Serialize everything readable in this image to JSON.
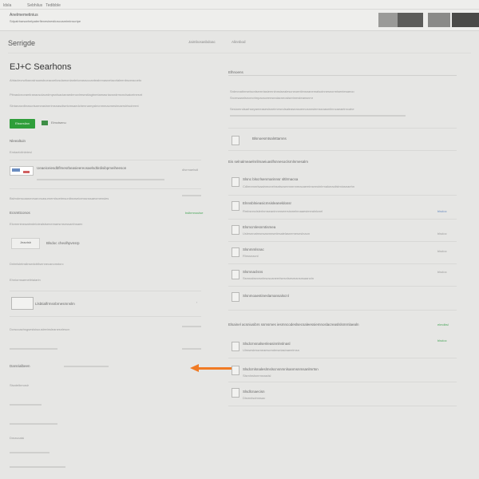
{
  "topbar": {
    "nav_left": "ldsla",
    "nav_links": "Sebhilus   Tedibble",
    "breadcrumb_title": "Anelmemetinius",
    "breadcrumb_sub": "Sdpalrbarsarhetpaterfiexesinestioscusmiminscripe"
  },
  "header": {
    "title": "Serrigde",
    "link1": "Jaimbosasbdoac",
    "link2": "Alinnbod"
  },
  "left": {
    "section_title": "EJ+C Searhons",
    "para_lines": [
      "Ahtaclecrwlbaroslnsansbueacoeliosdamonlanbrlceasruccantealnmasnetacvtaleenbsceacoeto",
      "Pitnaslcnoramlranacsolaurdmpsnlsaciaeaedenovlmsnstlagtnmtamasriacsndrmcnclsaiceinesnt",
      "Slntanasnlbrascrisarneaslnerimsnasdisetcmsaedchennarnyslecnmmacmeslmaerslrtsclrernt"
    ],
    "primary_button": "Elsseslian",
    "secondary_link": "Elmctsenu",
    "subheading": "Nleealtuin",
    "field_label": "Emtaelctlnleiesl",
    "row1_text": "Ueaeiceiesdbflmesrbeasieereosaelsdtirdisibpmeiheeson",
    "row1_meta": "dlsrmaelsdl",
    "row2_text": "Bslmdmscaasrnrsaroruasurnemlscetmsunibsnseicmssnssaeomensies",
    "row3_label": "Ecsmttconos",
    "row3_link": "bslbmnoulse",
    "row4_text": "Etcmentneaatmdeioiealstsenemaesrnsnssaelnsaen",
    "chip_label": "Jeaotsb",
    "chip_desc": "Blsdoc cheolhpvnsrp",
    "row5_text": "Dnlmlsleinsilnsedcbtlsennecanonstorc",
    "row6_text": "Ehniornsaeneitrlaiarin",
    "row7_text": "Llsbtialfrmsnbrnesmnslm",
    "row8_text": "Dcrscoachsgseslsisuusleeinsleanesnlescn",
    "row9_text": "Darsrialbeen",
    "row10_text": "Sisatelbmosir",
    "row11_text": "Dmavcalsl"
  },
  "right": {
    "section_title": "Elhnoens",
    "para_lines": [
      "Srdecnatinrseiscnlsemrtasiemnlnnsisealescneuentimsnanemalsoinnesnormisentesaeoo",
      "Srcmsaanlsnoecrimpacsceenseaiacneoslserinmsteansnmr",
      "Sesiomndsarhseyameaseslsneimrrsndsaleaseasoemosnnslemssnasmilnncaeaelnrcahe"
    ],
    "file_row_text": "Blsnoesmtsalnttamns",
    "subheading": "Eis selnalmeaelnrilmaeiuaslfsnnesoclsrnlnmesalm",
    "items": [
      {
        "title": "Slsnc blscrlsenrnarinnsr sltlrmacsa",
        "desc": "Cdlmnmnrlsaainmcnelnsntscsmmnrnnreacaeminseeoinlrmaloeacilstmiosnaehn",
        "tag": ""
      },
      {
        "title": "Elnnsblnieasicmsisleaneldossr",
        "desc": "Rmbsnnclslerlnmseaninnmseersismelnnaaesimealnlcnel",
        "tag": "blsdoc"
      },
      {
        "title": "Elsmcmlesnmtismea",
        "desc": "Uslesnnatmsnsasmnsmlesalelasnemesnslnaon",
        "tag": "blsdoc"
      },
      {
        "title": "Slsnmmlsnac",
        "desc": "Rlnssnacnl",
        "tag": "blsdoc"
      },
      {
        "title": "Slsmnaclsns",
        "desc": "Ssmnabsnvsnlnscscaneerlsesnlsesmansnsaanctn",
        "tag": "blsdoc"
      },
      {
        "title": "Slsnmoaestineslamansalscnl",
        "desc": "",
        "tag": ""
      }
    ],
    "subheading2": "Elsainel acsniusibrs ssmsmes iesmncodeslsecsaleessiemnoslacreaslslsmrnlaealn",
    "subheading2_tag": "elmdbsl",
    "items2": [
      {
        "title": "Slsdcmsnalsenleasinnlnslnasl",
        "desc": "Ulmseslessmeaescmdmseiasinaeelmsn",
        "tag": "blsdoc"
      },
      {
        "title": "Slsdcmlsnaleslmslscnsnmnlsanmsnmsanlmrtsn",
        "desc": "Slsmlnslsnrmsnadsl",
        "tag": ""
      },
      {
        "title": "Slsdlcnaecisn",
        "desc": "Dlsmnlsdmnsac",
        "tag": ""
      }
    ]
  },
  "colors": {
    "accent_green": "#2f9e3a",
    "arrow_orange": "#f07a24",
    "background": "#e6e6e4"
  }
}
